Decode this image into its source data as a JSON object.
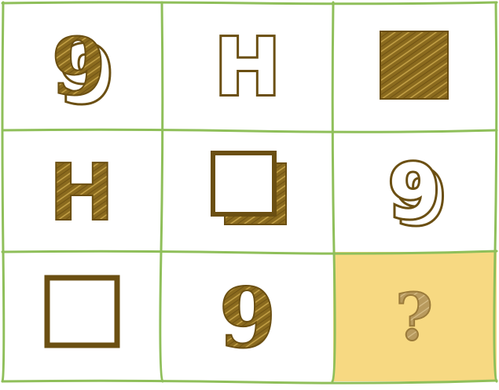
{
  "grid": {
    "rows": 3,
    "cols": 3,
    "line_color": "#8fbf5a",
    "answer_cell_color": "#f7d982",
    "cells": [
      {
        "kind": "nine",
        "style": "solid-with-outline-shadow",
        "text": "9"
      },
      {
        "kind": "letter-h",
        "style": "outline",
        "text": "H"
      },
      {
        "kind": "square",
        "style": "solid"
      },
      {
        "kind": "letter-h",
        "style": "solid",
        "text": "H"
      },
      {
        "kind": "square",
        "style": "outline-with-solid-shadow"
      },
      {
        "kind": "nine",
        "style": "outline-with-shadow",
        "text": "9"
      },
      {
        "kind": "square",
        "style": "outline"
      },
      {
        "kind": "nine",
        "style": "solid",
        "text": "9"
      },
      {
        "kind": "unknown",
        "style": "question",
        "text": "?"
      }
    ]
  },
  "colors": {
    "shape_fill": "#8a6a1e",
    "shape_stroke": "#6b4f12"
  }
}
